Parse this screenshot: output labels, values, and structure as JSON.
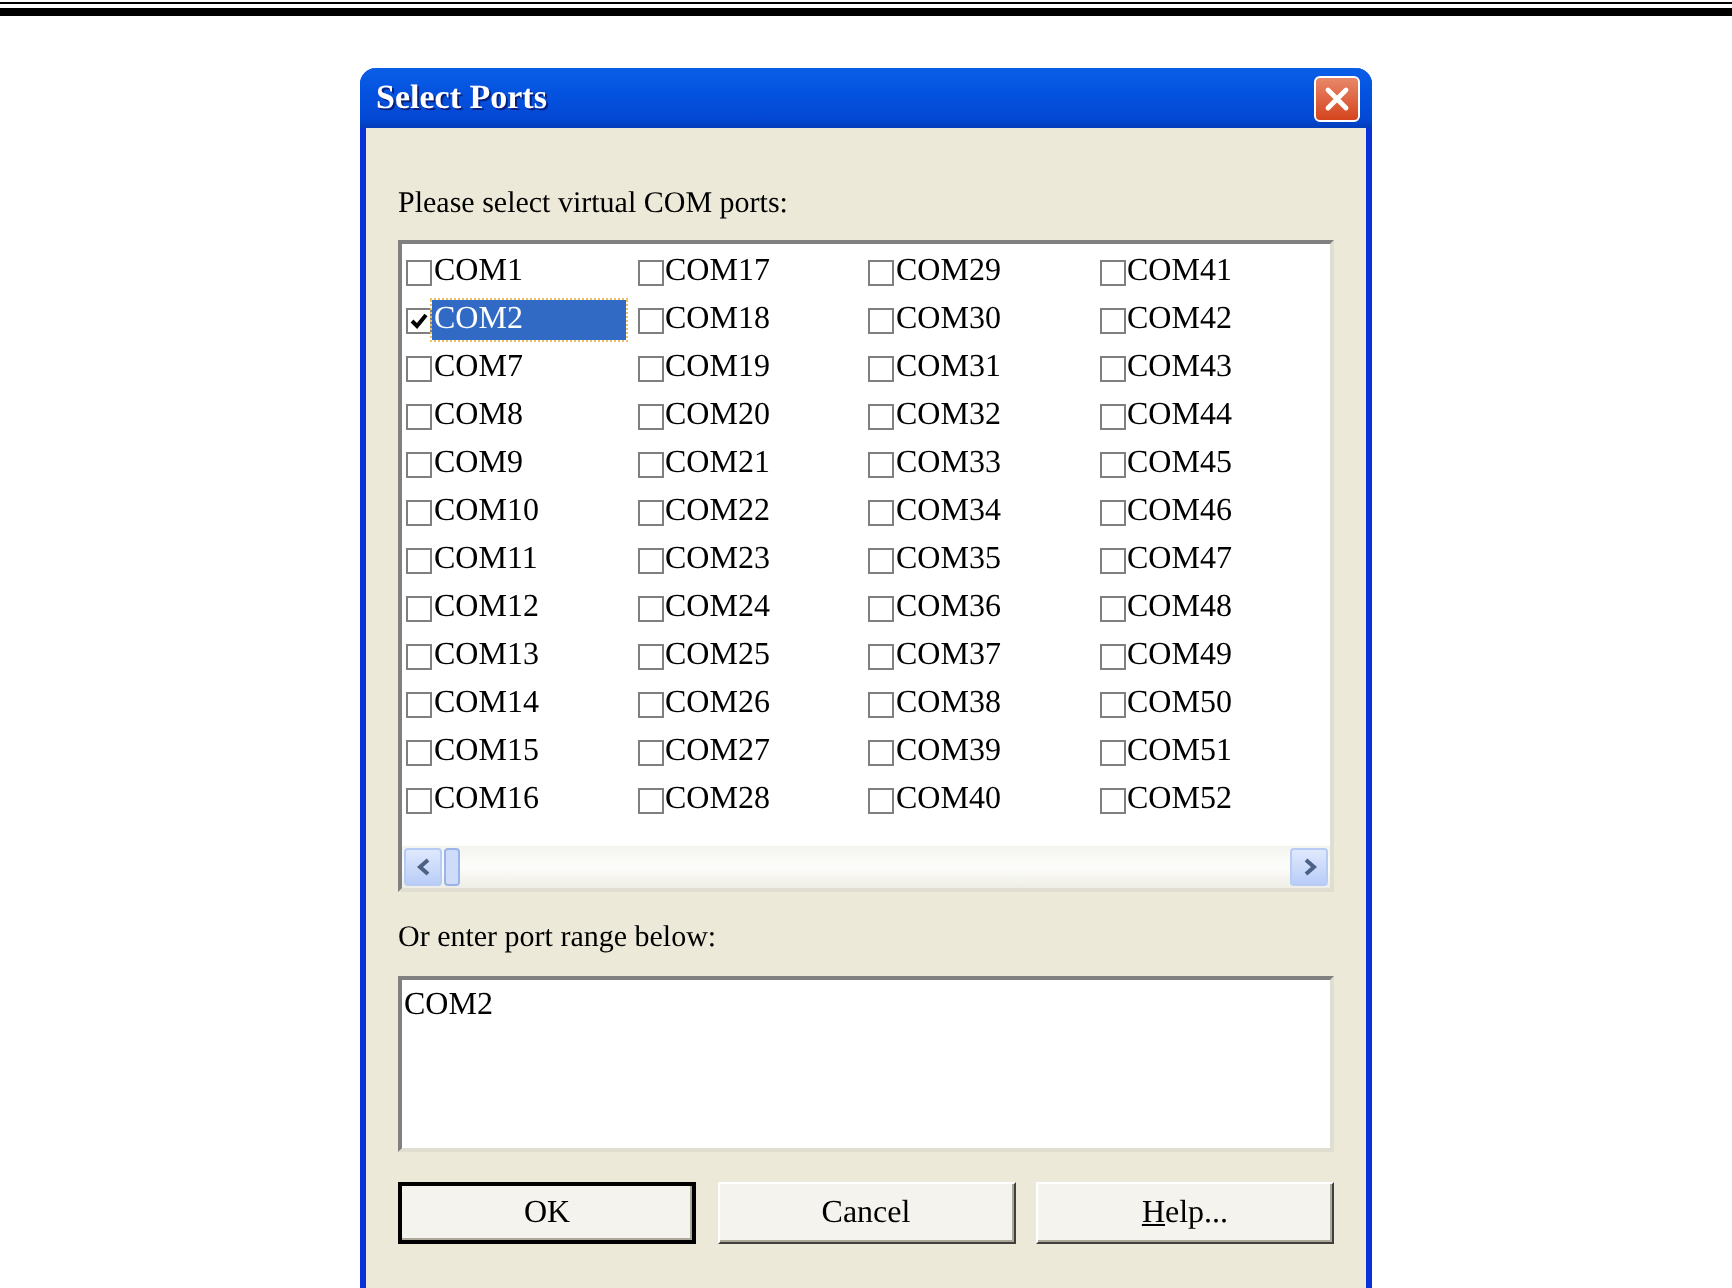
{
  "window": {
    "title": "Select Ports"
  },
  "list_label": "Please select virtual COM ports:",
  "columns": [
    [
      {
        "label": "COM1",
        "checked": false,
        "selected": false
      },
      {
        "label": "COM2",
        "checked": true,
        "selected": true
      },
      {
        "label": "COM7",
        "checked": false,
        "selected": false
      },
      {
        "label": "COM8",
        "checked": false,
        "selected": false
      },
      {
        "label": "COM9",
        "checked": false,
        "selected": false
      },
      {
        "label": "COM10",
        "checked": false,
        "selected": false
      },
      {
        "label": "COM11",
        "checked": false,
        "selected": false
      },
      {
        "label": "COM12",
        "checked": false,
        "selected": false
      },
      {
        "label": "COM13",
        "checked": false,
        "selected": false
      },
      {
        "label": "COM14",
        "checked": false,
        "selected": false
      },
      {
        "label": "COM15",
        "checked": false,
        "selected": false
      },
      {
        "label": "COM16",
        "checked": false,
        "selected": false
      }
    ],
    [
      {
        "label": "COM17",
        "checked": false,
        "selected": false
      },
      {
        "label": "COM18",
        "checked": false,
        "selected": false
      },
      {
        "label": "COM19",
        "checked": false,
        "selected": false
      },
      {
        "label": "COM20",
        "checked": false,
        "selected": false
      },
      {
        "label": "COM21",
        "checked": false,
        "selected": false
      },
      {
        "label": "COM22",
        "checked": false,
        "selected": false
      },
      {
        "label": "COM23",
        "checked": false,
        "selected": false
      },
      {
        "label": "COM24",
        "checked": false,
        "selected": false
      },
      {
        "label": "COM25",
        "checked": false,
        "selected": false
      },
      {
        "label": "COM26",
        "checked": false,
        "selected": false
      },
      {
        "label": "COM27",
        "checked": false,
        "selected": false
      },
      {
        "label": "COM28",
        "checked": false,
        "selected": false
      }
    ],
    [
      {
        "label": "COM29",
        "checked": false,
        "selected": false
      },
      {
        "label": "COM30",
        "checked": false,
        "selected": false
      },
      {
        "label": "COM31",
        "checked": false,
        "selected": false
      },
      {
        "label": "COM32",
        "checked": false,
        "selected": false
      },
      {
        "label": "COM33",
        "checked": false,
        "selected": false
      },
      {
        "label": "COM34",
        "checked": false,
        "selected": false
      },
      {
        "label": "COM35",
        "checked": false,
        "selected": false
      },
      {
        "label": "COM36",
        "checked": false,
        "selected": false
      },
      {
        "label": "COM37",
        "checked": false,
        "selected": false
      },
      {
        "label": "COM38",
        "checked": false,
        "selected": false
      },
      {
        "label": "COM39",
        "checked": false,
        "selected": false
      },
      {
        "label": "COM40",
        "checked": false,
        "selected": false
      }
    ],
    [
      {
        "label": "COM41",
        "checked": false,
        "selected": false
      },
      {
        "label": "COM42",
        "checked": false,
        "selected": false
      },
      {
        "label": "COM43",
        "checked": false,
        "selected": false
      },
      {
        "label": "COM44",
        "checked": false,
        "selected": false
      },
      {
        "label": "COM45",
        "checked": false,
        "selected": false
      },
      {
        "label": "COM46",
        "checked": false,
        "selected": false
      },
      {
        "label": "COM47",
        "checked": false,
        "selected": false
      },
      {
        "label": "COM48",
        "checked": false,
        "selected": false
      },
      {
        "label": "COM49",
        "checked": false,
        "selected": false
      },
      {
        "label": "COM50",
        "checked": false,
        "selected": false
      },
      {
        "label": "COM51",
        "checked": false,
        "selected": false
      },
      {
        "label": "COM52",
        "checked": false,
        "selected": false
      }
    ]
  ],
  "range_label": "Or enter port range below:",
  "range_value": "COM2",
  "buttons": [
    {
      "label": "OK",
      "default": true
    },
    {
      "label": "Cancel",
      "default": false
    },
    {
      "accelerator_key": "H",
      "label": "elp...",
      "default": false
    }
  ]
}
